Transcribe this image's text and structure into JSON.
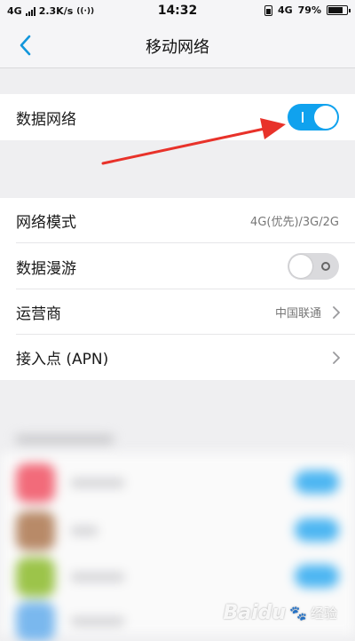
{
  "status_bar": {
    "network_type": "4G",
    "speed": "2.3K/s",
    "time": "14:32",
    "network_type_right": "4G",
    "battery": "79%"
  },
  "header": {
    "title": "移动网络"
  },
  "settings": {
    "data_network": {
      "label": "数据网络",
      "enabled": true
    },
    "network_mode": {
      "label": "网络模式",
      "value": "4G(优先)/3G/2G"
    },
    "data_roaming": {
      "label": "数据漫游",
      "enabled": false
    },
    "carrier": {
      "label": "运营商",
      "value": "中国联通"
    },
    "apn": {
      "label": "接入点 (APN)"
    }
  },
  "watermark": {
    "brand": "Baidu",
    "suffix": "经验"
  },
  "colors": {
    "accent": "#10a2ee",
    "arrow": "#e8322a"
  }
}
